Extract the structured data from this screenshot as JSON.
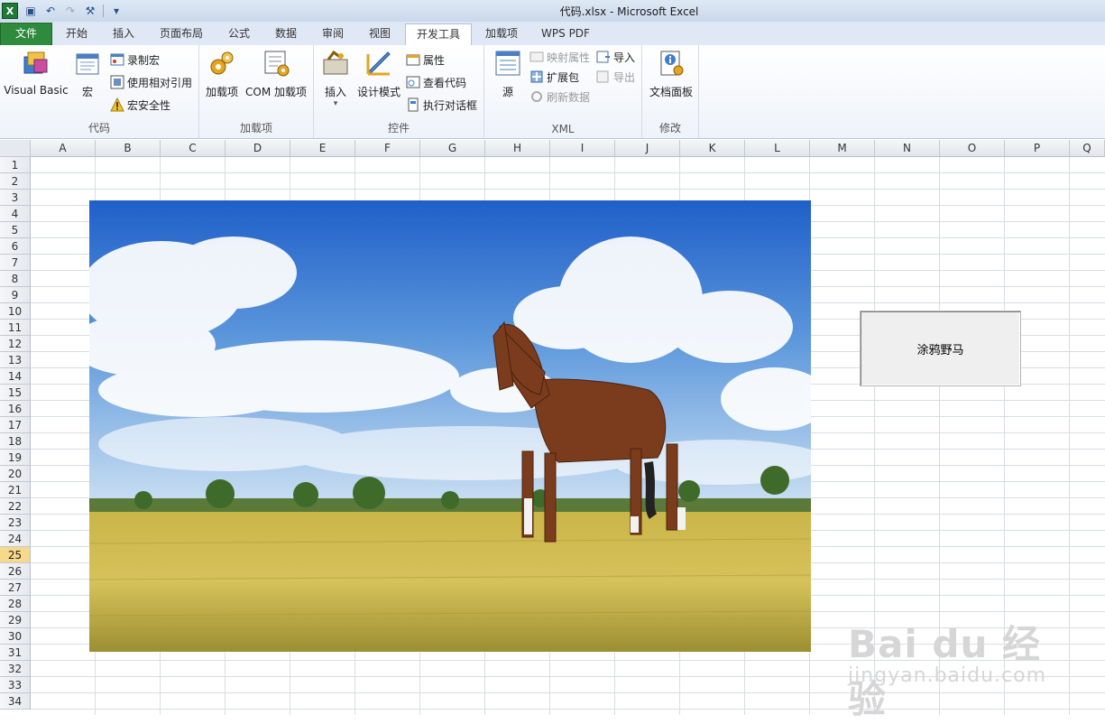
{
  "window": {
    "title": "代码.xlsx  -  Microsoft Excel"
  },
  "tabs": [
    {
      "label": "文件"
    },
    {
      "label": "开始"
    },
    {
      "label": "插入"
    },
    {
      "label": "页面布局"
    },
    {
      "label": "公式"
    },
    {
      "label": "数据"
    },
    {
      "label": "审阅"
    },
    {
      "label": "视图"
    },
    {
      "label": "开发工具"
    },
    {
      "label": "加载项"
    },
    {
      "label": "WPS PDF"
    }
  ],
  "ribbon": {
    "code_group": {
      "label": "代码",
      "visual_basic": "Visual Basic",
      "macros": "宏",
      "record_macro": "录制宏",
      "relative_ref": "使用相对引用",
      "macro_security": "宏安全性"
    },
    "addins_group": {
      "label": "加载项",
      "addins": "加载项",
      "com_addins": "COM 加载项"
    },
    "controls_group": {
      "label": "控件",
      "insert": "插入",
      "design_mode": "设计模式",
      "properties": "属性",
      "view_code": "查看代码",
      "run_dialog": "执行对话框"
    },
    "xml_group": {
      "label": "XML",
      "source": "源",
      "map_props": "映射属性",
      "expansion_packs": "扩展包",
      "refresh_data": "刷新数据",
      "import": "导入",
      "export": "导出"
    },
    "modify_group": {
      "label": "修改",
      "doc_panel": "文档面板"
    }
  },
  "sheet": {
    "columns": [
      "A",
      "B",
      "C",
      "D",
      "E",
      "F",
      "G",
      "H",
      "I",
      "J",
      "K",
      "L",
      "M",
      "N",
      "O",
      "P",
      "Q"
    ],
    "rows": [
      "1",
      "2",
      "3",
      "4",
      "5",
      "6",
      "7",
      "8",
      "9",
      "10",
      "11",
      "12",
      "13",
      "14",
      "15",
      "16",
      "17",
      "18",
      "19",
      "20",
      "21",
      "22",
      "23",
      "24",
      "25",
      "26",
      "27",
      "28",
      "29",
      "30",
      "31",
      "32",
      "33",
      "34"
    ],
    "selected_row": "25"
  },
  "form_button": {
    "label": "涂鸦野马"
  },
  "watermark": {
    "main": "Bai du 经验",
    "sub": "jingyan.baidu.com"
  }
}
